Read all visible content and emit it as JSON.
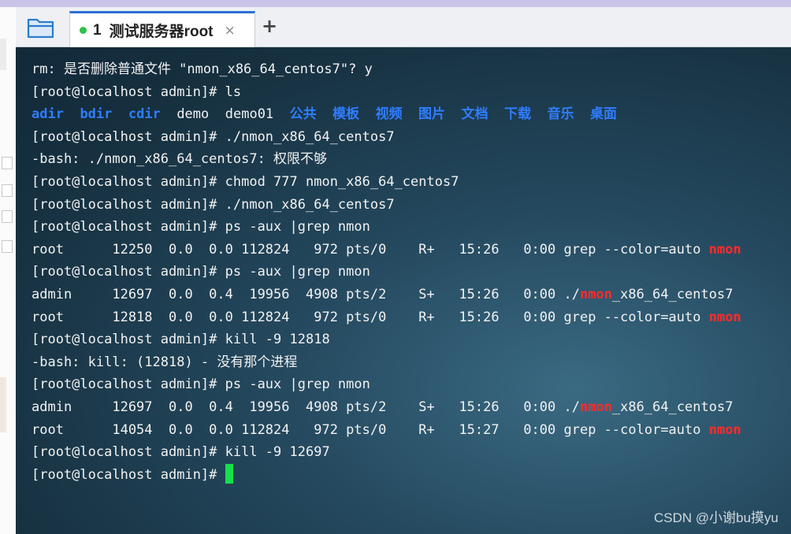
{
  "tab": {
    "number": "1",
    "title": "测试服务器root",
    "close": "×"
  },
  "new_tab": "+",
  "watermark": "CSDN @小谢bu摸yu",
  "colors": {
    "directory": "#2f7dff",
    "grep_match": "#ff2a2a",
    "cursor": "#14e04a"
  },
  "terminal": {
    "l1": {
      "text": "rm: 是否删除普通文件 \"nmon_x86_64_centos7\"? y"
    },
    "l2": {
      "text": "[root@localhost admin]# ls"
    },
    "l3": {
      "d1": "adir",
      "d2": "bdir",
      "d3": "cdir",
      "f1": "demo",
      "f2": "demo01",
      "d4": "公共",
      "d5": "模板",
      "d6": "视频",
      "d7": "图片",
      "d8": "文档",
      "d9": "下载",
      "d10": "音乐",
      "d11": "桌面"
    },
    "l4": {
      "text": "[root@localhost admin]# ./nmon_x86_64_centos7"
    },
    "l5": {
      "text": "-bash: ./nmon_x86_64_centos7: 权限不够"
    },
    "l6": {
      "text": "[root@localhost admin]# chmod 777 nmon_x86_64_centos7"
    },
    "l7": {
      "text": "[root@localhost admin]# ./nmon_x86_64_centos7"
    },
    "l8": {
      "text": "[root@localhost admin]# ps -aux |grep nmon"
    },
    "l9": {
      "pre": "root      12250  0.0  0.0 112824   972 pts/0    R+   15:26   0:00 grep --color=auto ",
      "match": "nmon"
    },
    "l10": {
      "text": "[root@localhost admin]# ps -aux |grep nmon"
    },
    "l11": {
      "pre": "admin     12697  0.0  0.4  19956  4908 pts/2    S+   15:26   0:00 ./",
      "match": "nmon",
      "post": "_x86_64_centos7"
    },
    "l12": {
      "pre": "root      12818  0.0  0.0 112824   972 pts/0    R+   15:26   0:00 grep --color=auto ",
      "match": "nmon"
    },
    "l13": {
      "text": "[root@localhost admin]# kill -9 12818"
    },
    "l14": {
      "text": "-bash: kill: (12818) - 没有那个进程"
    },
    "l15": {
      "text": "[root@localhost admin]# ps -aux |grep nmon"
    },
    "l16": {
      "pre": "admin     12697  0.0  0.4  19956  4908 pts/2    S+   15:26   0:00 ./",
      "match": "nmon",
      "post": "_x86_64_centos7"
    },
    "l17": {
      "pre": "root      14054  0.0  0.0 112824   972 pts/0    R+   15:27   0:00 grep --color=auto ",
      "match": "nmon"
    },
    "l18": {
      "text": "[root@localhost admin]# kill -9 12697"
    },
    "l19": {
      "text": "[root@localhost admin]# "
    }
  }
}
